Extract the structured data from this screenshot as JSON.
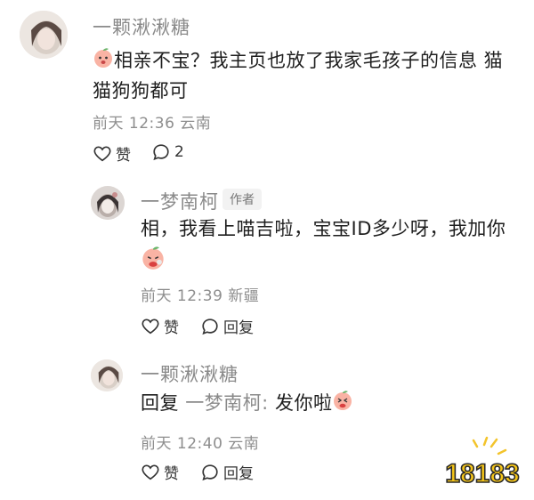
{
  "comment1": {
    "username": "一颗湫湫糖",
    "text_line1": "相亲不宝？我主页也放了我家毛孩子的信息 猫",
    "text_line2": "猫狗狗都可",
    "meta": "前天 12:36 云南",
    "like_label": "赞",
    "reply_count": "2"
  },
  "reply1": {
    "username": "一梦南柯",
    "author_badge": "作者",
    "text": "相，我看上喵吉啦，宝宝ID多少呀，我加你",
    "meta": "前天 12:39 新疆",
    "like_label": "赞",
    "reply_label": "回复"
  },
  "reply2": {
    "username": "一颗湫湫糖",
    "text_prefix": "回复",
    "mention": "一梦南柯:",
    "text_body": "发你啦",
    "meta": "前天 12:40 云南",
    "like_label": "赞",
    "reply_label": "回复"
  },
  "watermark": {
    "text": "18183"
  },
  "icons": {
    "like": "heart-outline-icon",
    "comment": "speech-bubble-icon",
    "emoji": "peach-face-emoji",
    "accent": "#f28a7a"
  }
}
